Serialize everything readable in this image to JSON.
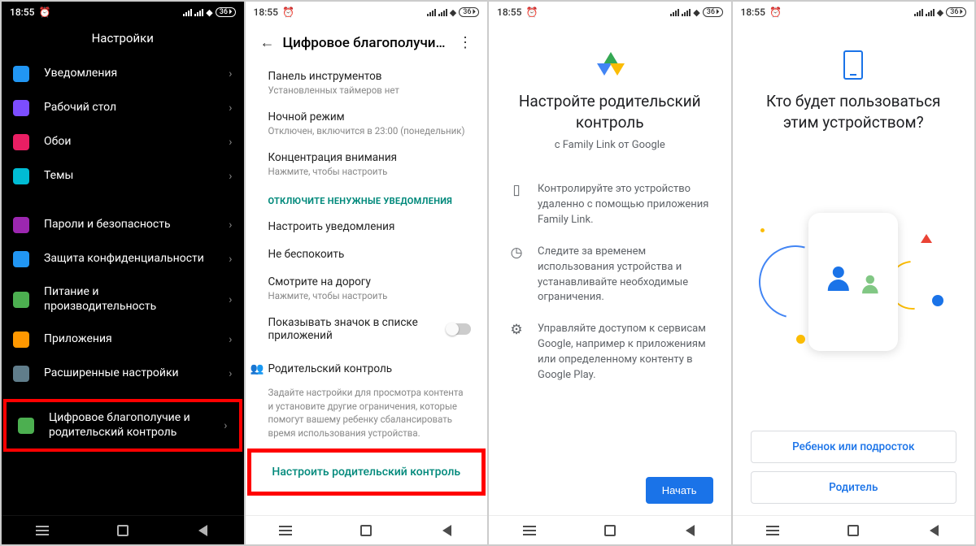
{
  "status": {
    "time": "18:55",
    "battery": "36"
  },
  "screen1": {
    "title": "Настройки",
    "items": [
      {
        "label": "Уведомления",
        "icon_color": "#2196f3"
      },
      {
        "label": "Рабочий стол",
        "icon_color": "#7c4dff"
      },
      {
        "label": "Обои",
        "icon_color": "#e91e63"
      },
      {
        "label": "Темы",
        "icon_color": "#00bcd4"
      }
    ],
    "items2": [
      {
        "label": "Пароли и безопасность",
        "icon_color": "#9c27b0"
      },
      {
        "label": "Защита конфиденциальности",
        "icon_color": "#2196f3"
      },
      {
        "label": "Питание и\nпроизводительность",
        "icon_color": "#4caf50"
      },
      {
        "label": "Приложения",
        "icon_color": "#ff9800"
      },
      {
        "label": "Расширенные настройки",
        "icon_color": "#607d8b"
      }
    ],
    "highlighted": {
      "label": "Цифровое благополучие и родительский контроль",
      "icon_color": "#4caf50"
    }
  },
  "screen2": {
    "title": "Цифровое благополучи…",
    "items_a": [
      {
        "primary": "Панель инструментов",
        "secondary": "Установленных таймеров нет"
      },
      {
        "primary": "Ночной режим",
        "secondary": "Отключен, включится в 23:00 (понедельник)"
      },
      {
        "primary": "Концентрация внимания",
        "secondary": "Нажмите, чтобы настроить"
      }
    ],
    "section_label": "ОТКЛЮЧИТЕ НЕНУЖНЫЕ УВЕДОМЛЕНИЯ",
    "items_b": [
      {
        "primary": "Настроить уведомления"
      },
      {
        "primary": "Не беспокоить"
      },
      {
        "primary": "Смотрите на дорогу",
        "secondary": "Нажмите, чтобы настроить"
      }
    ],
    "toggle_label": "Показывать значок в списке приложений",
    "parental_title": "Родительский контроль",
    "parental_desc": "Задайте настройки для просмотра контента и установите другие ограничения, которые помогут вашему ребенку сбалансировать время использования устройства.",
    "cta": "Настроить родительский контроль"
  },
  "screen3": {
    "h1": "Настройте родительский контроль",
    "sub": "с Family Link от Google",
    "features": [
      "Контролируйте это устройство удаленно с помощью приложения Family Link.",
      "Следите за временем использования устройства и устанавливайте необходимые ограничения.",
      "Управляйте доступом к сервисам Google, например к приложениям или определенному контенту в Google Play."
    ],
    "btn": "Начать"
  },
  "screen4": {
    "h1": "Кто будет пользоваться этим устройством?",
    "btn_child": "Ребенок или подросток",
    "btn_parent": "Родитель"
  }
}
